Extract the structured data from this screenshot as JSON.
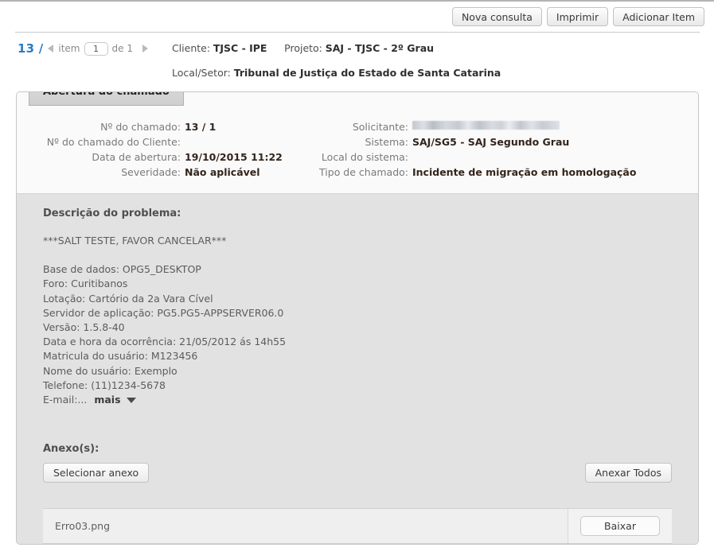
{
  "toolbar": {
    "buttons": [
      {
        "label": "Nova consulta",
        "name": "nova-consulta-button"
      },
      {
        "label": "Imprimir",
        "name": "imprimir-button"
      },
      {
        "label": "Adicionar Item",
        "name": "adicionar-item-button"
      }
    ]
  },
  "pager": {
    "record_number": "13 /",
    "item_word": "item",
    "item_value": "1",
    "of_text": "de 1"
  },
  "breadcrumb": {
    "cliente_label": "Cliente:",
    "cliente_value": "TJSC - IPE",
    "projeto_label": "Projeto:",
    "projeto_value": "SAJ - TJSC - 2º Grau",
    "local_label": "Local/Setor:",
    "local_value": "Tribunal de Justiça do Estado de Santa Catarina"
  },
  "panel": {
    "tab_label": "Abertura do chamado",
    "fields_left": [
      {
        "label": "Nº do chamado:",
        "value": "13 / 1"
      },
      {
        "label": "Nº do chamado do Cliente:",
        "value": ""
      },
      {
        "label": "Data de abertura:",
        "value": "19/10/2015 11:22"
      },
      {
        "label": "Severidade:",
        "value": "Não aplicável"
      }
    ],
    "fields_right": [
      {
        "label": "Solicitante:",
        "value": "",
        "redacted": true
      },
      {
        "label": "Sistema:",
        "value": "SAJ/SG5 - SAJ Segundo Grau"
      },
      {
        "label": "Local do sistema:",
        "value": ""
      },
      {
        "label": "Tipo de chamado:",
        "value": "Incidente de migração em homologação"
      }
    ]
  },
  "description": {
    "title": "Descrição do problema:",
    "lines": [
      "***SALT TESTE, FAVOR CANCELAR***",
      "",
      "Base de dados: OPG5_DESKTOP",
      "Foro: Curitibanos",
      "Lotação: Cartório da 2a Vara Cível",
      "Servidor de aplicação: PG5.PG5-APPSERVER06.0",
      "Versão: 1.5.8-40",
      "Data e hora da ocorrência: 21/05/2012 ás 14h55",
      "Matricula do usuário: M123456",
      "Nome do usuário: Exemplo",
      "Telefone: (11)1234-5678"
    ],
    "email_label": "E-mail:...",
    "more_label": "mais"
  },
  "attachments": {
    "title": "Anexo(s):",
    "select_button": "Selecionar anexo",
    "attach_all_button": "Anexar Todos",
    "files": [
      {
        "name": "Erro03.png",
        "action": "Baixar"
      }
    ]
  }
}
